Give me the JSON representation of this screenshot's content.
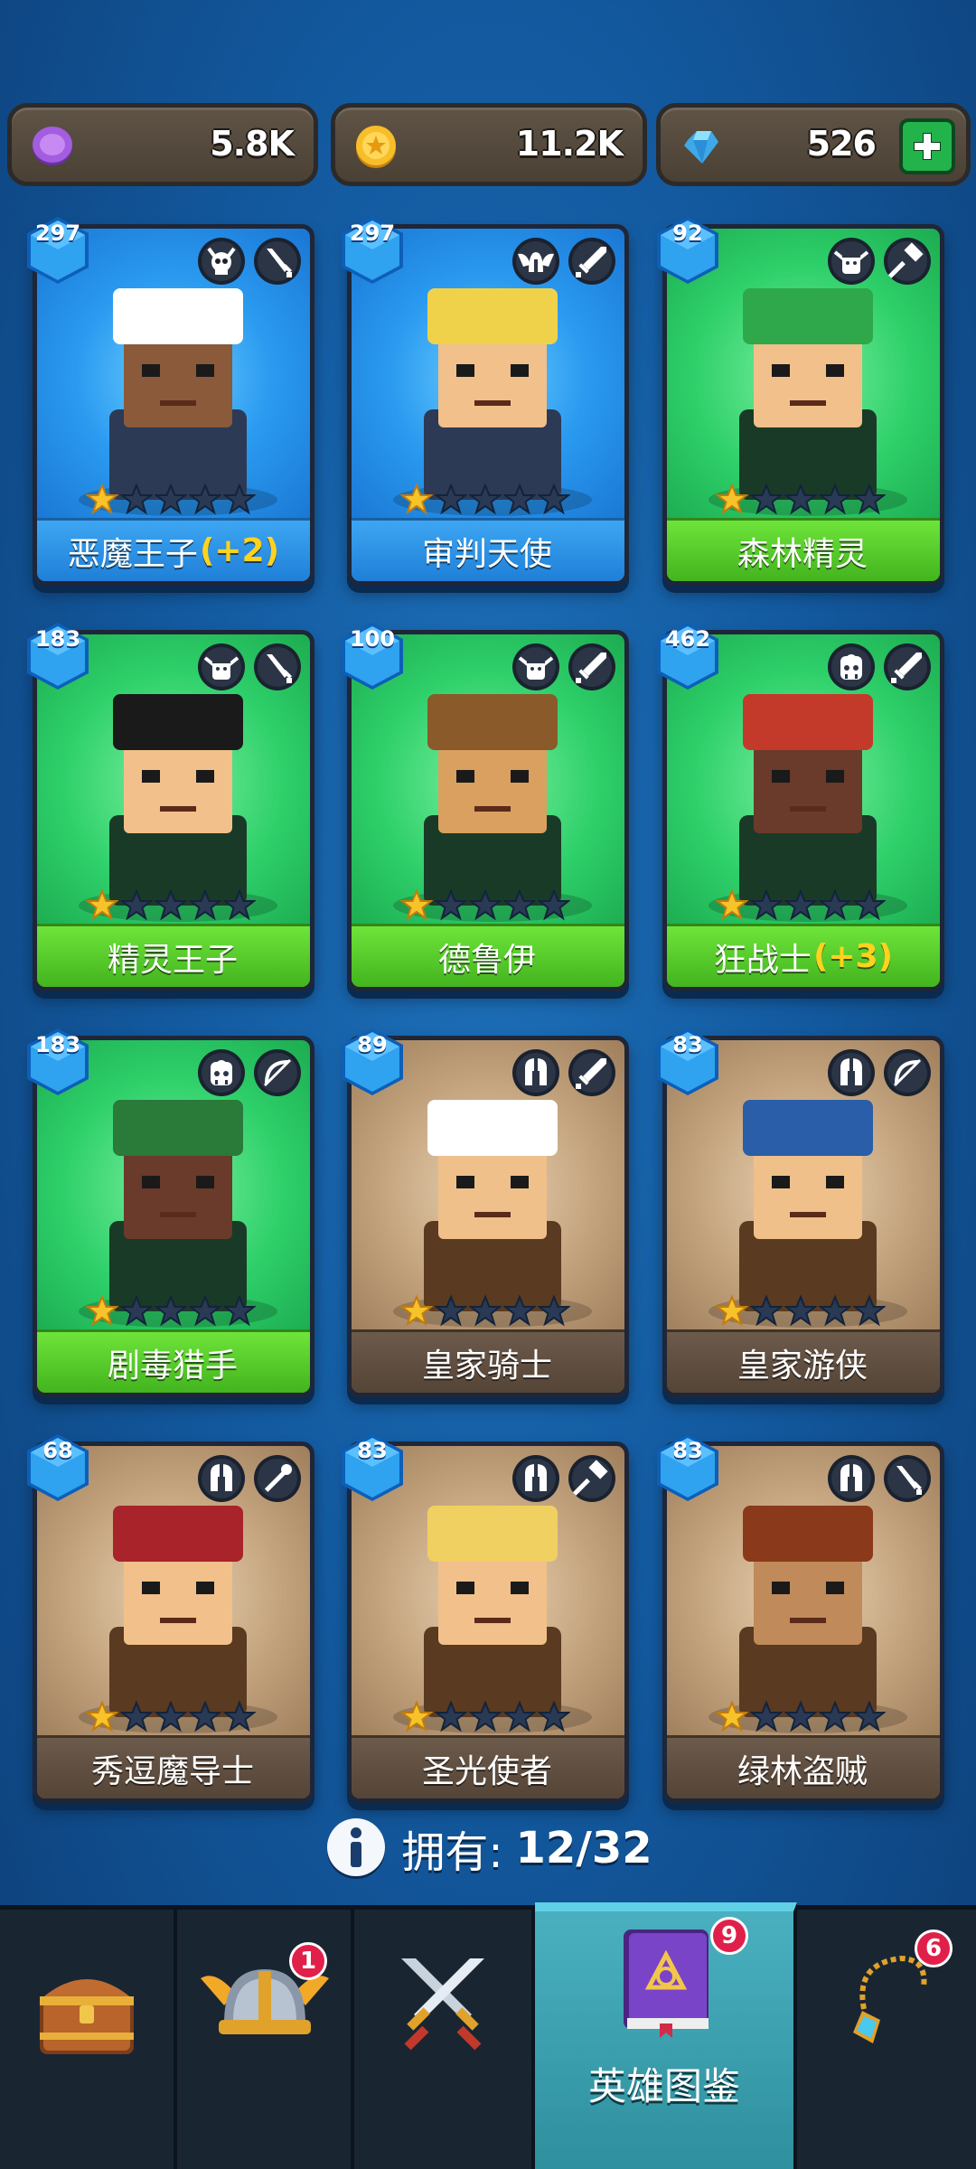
{
  "currencies": [
    {
      "name": "purple-coin",
      "value": "5.8K",
      "color": "#9b4fd6"
    },
    {
      "name": "gold-coin",
      "value": "11.2K",
      "color": "#f5b720"
    },
    {
      "name": "diamond",
      "value": "526",
      "color": "#4fc8f0"
    }
  ],
  "heroes": [
    {
      "name": "恶魔王子",
      "bonus": "(+2)",
      "level": "297",
      "rarity": "blue",
      "stars": 1,
      "class_icon": "skull-icon",
      "weapon_icon": "dagger-icon"
    },
    {
      "name": "审判天使",
      "bonus": "",
      "level": "297",
      "rarity": "blue",
      "stars": 1,
      "class_icon": "winged-helm-icon",
      "weapon_icon": "sword-icon"
    },
    {
      "name": "森林精灵",
      "bonus": "",
      "level": "92",
      "rarity": "green",
      "stars": 1,
      "class_icon": "elf-icon",
      "weapon_icon": "hammer-icon"
    },
    {
      "name": "精灵王子",
      "bonus": "",
      "level": "183",
      "rarity": "green",
      "stars": 1,
      "class_icon": "elf-icon",
      "weapon_icon": "dagger-icon"
    },
    {
      "name": "德鲁伊",
      "bonus": "",
      "level": "100",
      "rarity": "green",
      "stars": 1,
      "class_icon": "elf-icon",
      "weapon_icon": "sword-icon"
    },
    {
      "name": "狂战士",
      "bonus": "(+3)",
      "level": "462",
      "rarity": "green",
      "stars": 1,
      "class_icon": "orc-icon",
      "weapon_icon": "sword-icon"
    },
    {
      "name": "剧毒猎手",
      "bonus": "",
      "level": "183",
      "rarity": "green",
      "stars": 1,
      "class_icon": "orc-icon",
      "weapon_icon": "bow-icon"
    },
    {
      "name": "皇家骑士",
      "bonus": "",
      "level": "89",
      "rarity": "brown",
      "stars": 1,
      "class_icon": "knight-helm-icon",
      "weapon_icon": "sword-icon"
    },
    {
      "name": "皇家游侠",
      "bonus": "",
      "level": "83",
      "rarity": "brown",
      "stars": 1,
      "class_icon": "knight-helm-icon",
      "weapon_icon": "bow-icon"
    },
    {
      "name": "秀逗魔导士",
      "bonus": "",
      "level": "68",
      "rarity": "brown",
      "stars": 1,
      "class_icon": "knight-helm-icon",
      "weapon_icon": "staff-icon"
    },
    {
      "name": "圣光使者",
      "bonus": "",
      "level": "83",
      "rarity": "brown",
      "stars": 1,
      "class_icon": "knight-helm-icon",
      "weapon_icon": "hammer-icon"
    },
    {
      "name": "绿林盗贼",
      "bonus": "",
      "level": "83",
      "rarity": "brown",
      "stars": 1,
      "class_icon": "knight-helm-icon",
      "weapon_icon": "dagger-icon"
    }
  ],
  "owned": {
    "label": "拥有:",
    "count": "12/32"
  },
  "nav": [
    {
      "name": "chest-tab",
      "icon": "treasure-chest-icon",
      "badge": ""
    },
    {
      "name": "heroes-tab",
      "icon": "viking-helmet-icon",
      "badge": "1"
    },
    {
      "name": "battle-tab",
      "icon": "crossed-swords-icon",
      "badge": ""
    },
    {
      "name": "hero-codex-tab",
      "icon": "spellbook-icon",
      "badge": "9",
      "label": "英雄图鉴",
      "active": true
    },
    {
      "name": "amulet-tab",
      "icon": "amulet-icon",
      "badge": "6"
    }
  ]
}
